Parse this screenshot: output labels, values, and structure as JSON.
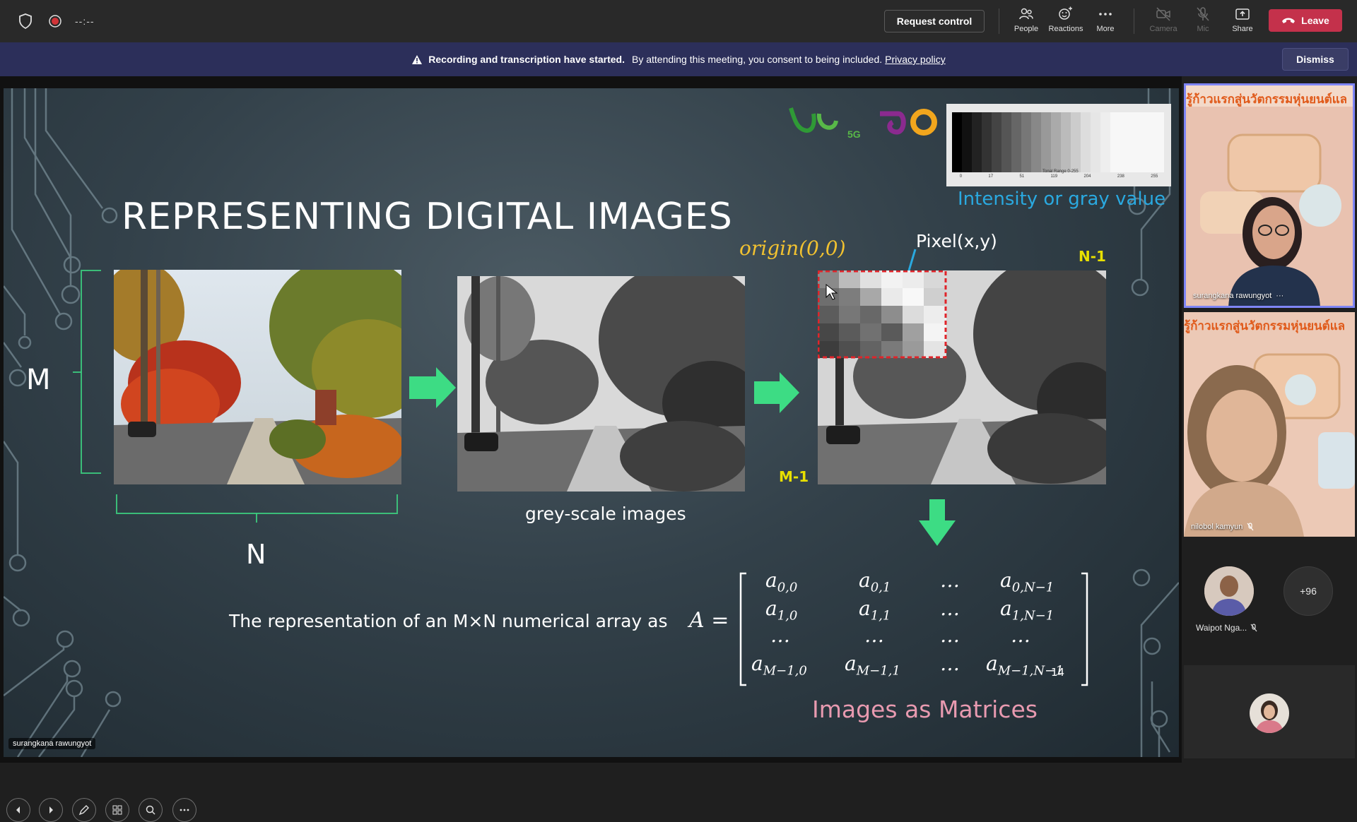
{
  "topbar": {
    "timer": "--:--",
    "request_control": "Request control",
    "tools": {
      "people": "People",
      "reactions": "Reactions",
      "more": "More",
      "camera": "Camera",
      "mic": "Mic",
      "share": "Share"
    },
    "leave": "Leave"
  },
  "banner": {
    "bold": "Recording and transcription have started.",
    "text": "By attending this meeting, you consent to being included.",
    "link": "Privacy policy",
    "dismiss": "Dismiss"
  },
  "slide": {
    "title": "REPRESENTING DIGITAL IMAGES",
    "m_label": "M",
    "n_label": "N",
    "grey_caption": "grey-scale images",
    "origin": "origin(0,0)",
    "pixel": "Pixel(x,y)",
    "n1": "N-1",
    "m1": "M-1",
    "intensity": "Intensity or gray value",
    "matrix_text": "The representation of an M×N numerical array as",
    "matrix_eq": "A =",
    "matrix_cells": [
      [
        "a",
        "0,0"
      ],
      [
        "a",
        "0,1"
      ],
      [
        "…",
        ""
      ],
      [
        "a",
        "0,N−1"
      ],
      [
        "a",
        "1,0"
      ],
      [
        "a",
        "1,1"
      ],
      [
        "…",
        ""
      ],
      [
        "a",
        "1,N−1"
      ],
      [
        "…",
        ""
      ],
      [
        "…",
        ""
      ],
      [
        "…",
        ""
      ],
      [
        "…",
        ""
      ],
      [
        "a",
        "M−1,0"
      ],
      [
        "a",
        "M−1,1"
      ],
      [
        "…",
        ""
      ],
      [
        "a",
        "M−1,N−1"
      ]
    ],
    "page_number": "14",
    "caption": "Images as Matrices",
    "gray_scale_ticks": [
      "0",
      "17",
      "51",
      "119",
      "204",
      "238",
      "255"
    ],
    "gray_scale_label": "Tonal Range 0-255",
    "presenter_name": "surangkana rawungyot",
    "logo_text": "5G"
  },
  "participants": {
    "tile1_name": "surangkana rawungyot",
    "tile1_banner": "รู้ก้าวแรกสู่นวัตกรรมหุ่นยนต์แล",
    "tile2_name": "nilobol kamyun",
    "tile2_banner": "รู้ก้าวแรกสู่นวัตกรรมหุ่นยนต์แล",
    "avatar_name": "Waipot Nga...",
    "more_count": "+96"
  },
  "colors": {
    "accent_leave": "#c4314b",
    "banner_bg": "#2c2f5a",
    "intensity_blue": "#2aa9e0",
    "origin_yellow": "#f2c230",
    "label_yellow": "#e8e000",
    "caption_pink": "#e89ab0",
    "arrow_green": "#3ddc84"
  }
}
